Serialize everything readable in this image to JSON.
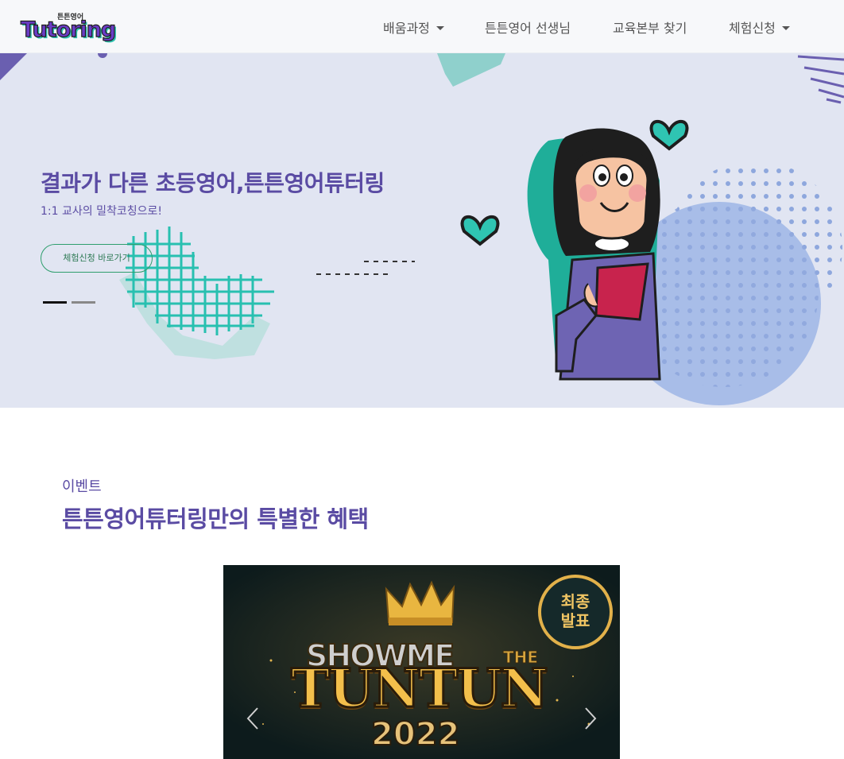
{
  "logo": {
    "small": "튼튼영어",
    "main": "Tutoring"
  },
  "nav": {
    "items": [
      {
        "label": "배움과정",
        "dropdown": true
      },
      {
        "label": "튼튼영어 선생님",
        "dropdown": false
      },
      {
        "label": "교육본부 찾기",
        "dropdown": false
      },
      {
        "label": "체험신청",
        "dropdown": true
      }
    ]
  },
  "hero": {
    "title": "결과가 다른 초등영어,튼튼영어튜터링",
    "subtitle": "1:1 교사의 밀착코칭으로!",
    "button_label": "체험신청 바로가기",
    "slide_count": 2,
    "active_slide": 1
  },
  "event_section": {
    "eyebrow": "이벤트",
    "title": "튼튼영어튜터링만의 특별한 혜택"
  },
  "banner": {
    "badge_line1": "최종",
    "badge_line2": "발표",
    "show_text": "SHOWME",
    "the_text": "THE",
    "main_text": "TUNTUN",
    "year": "2022"
  },
  "colors": {
    "brand_purple": "#5a4ba3",
    "hero_bg": "#e1e5f2",
    "teal": "#2fc4b2",
    "nav_bg": "#f7f8fa"
  }
}
